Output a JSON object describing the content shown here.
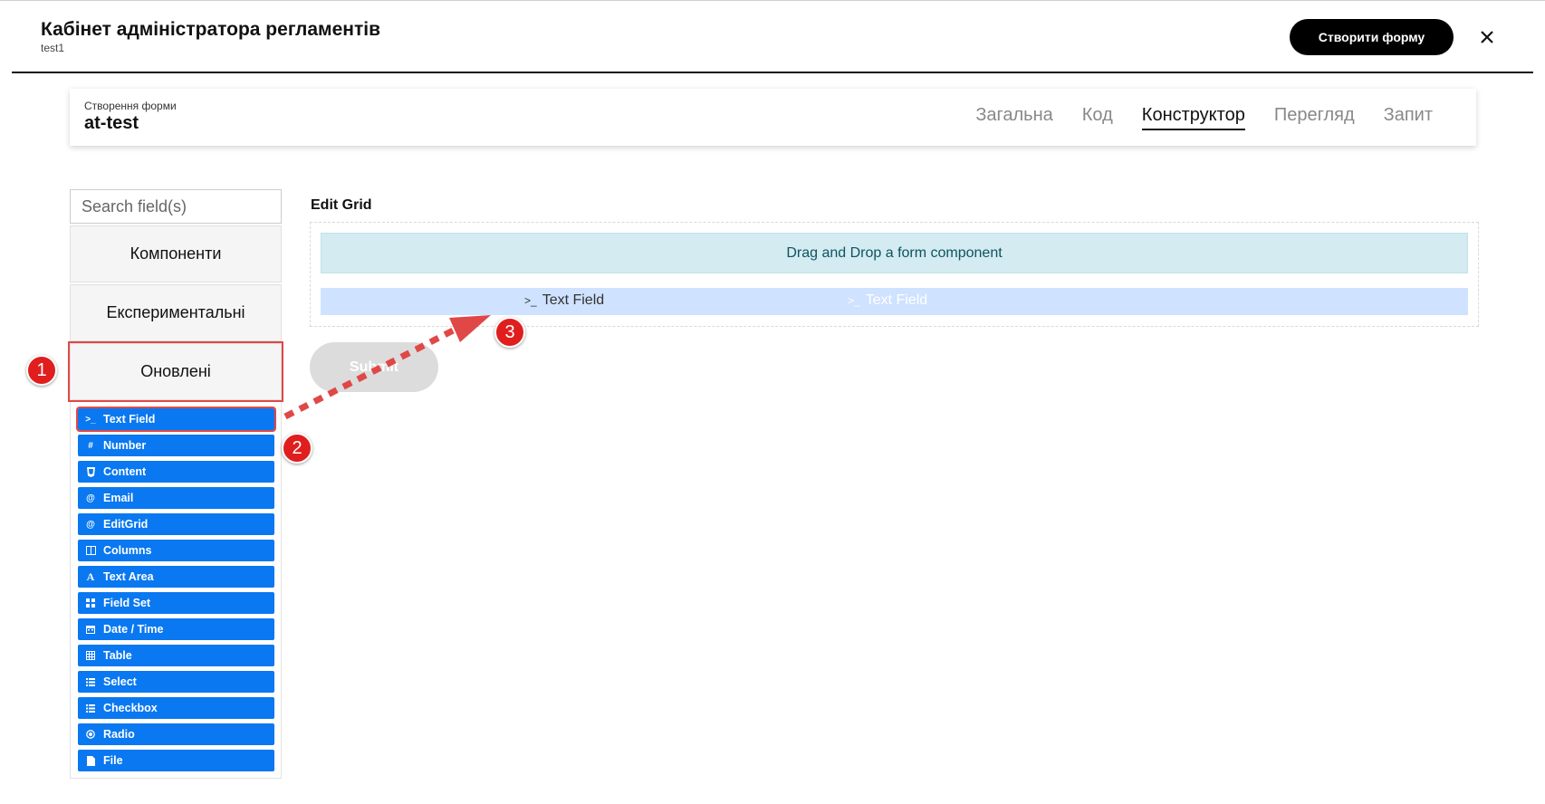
{
  "header": {
    "title": "Кабінет адміністратора регламентів",
    "subtitle": "test1",
    "create_button": "Створити форму"
  },
  "form": {
    "caption": "Створення форми",
    "name": "at-test",
    "tabs": [
      {
        "label": "Загальна"
      },
      {
        "label": "Код"
      },
      {
        "label": "Конструктор",
        "active": true
      },
      {
        "label": "Перегляд"
      },
      {
        "label": "Запит"
      }
    ]
  },
  "sidebar": {
    "search_placeholder": "Search field(s)",
    "groups": [
      "Компоненти",
      "Експериментальні",
      "Оновлені"
    ],
    "components": [
      {
        "label": "Text Field",
        "icon": ">_"
      },
      {
        "label": "Number",
        "icon": "#"
      },
      {
        "label": "Content",
        "icon": "html5"
      },
      {
        "label": "Email",
        "icon": "@"
      },
      {
        "label": "EditGrid",
        "icon": "@"
      },
      {
        "label": "Columns",
        "icon": "columns"
      },
      {
        "label": "Text Area",
        "icon": "A"
      },
      {
        "label": "Field Set",
        "icon": "grid"
      },
      {
        "label": "Date / Time",
        "icon": "calendar"
      },
      {
        "label": "Table",
        "icon": "table"
      },
      {
        "label": "Select",
        "icon": "list"
      },
      {
        "label": "Checkbox",
        "icon": "list"
      },
      {
        "label": "Radio",
        "icon": "radio"
      },
      {
        "label": "File",
        "icon": "file"
      }
    ]
  },
  "builder": {
    "edit_grid_label": "Edit Grid",
    "dropzone_text": "Drag and Drop a form component",
    "drag_label": "Text Field",
    "drag_ghost_label": "Text Field",
    "submit_label": "Submit"
  },
  "annotations": {
    "marker_1": "1",
    "marker_2": "2",
    "marker_3": "3"
  },
  "colors": {
    "component_blue": "#0a78f0",
    "annotation_red": "#e01e1e",
    "dropzone_bg": "#d4ebf1",
    "drag_row_bg": "#cfe2ff"
  }
}
